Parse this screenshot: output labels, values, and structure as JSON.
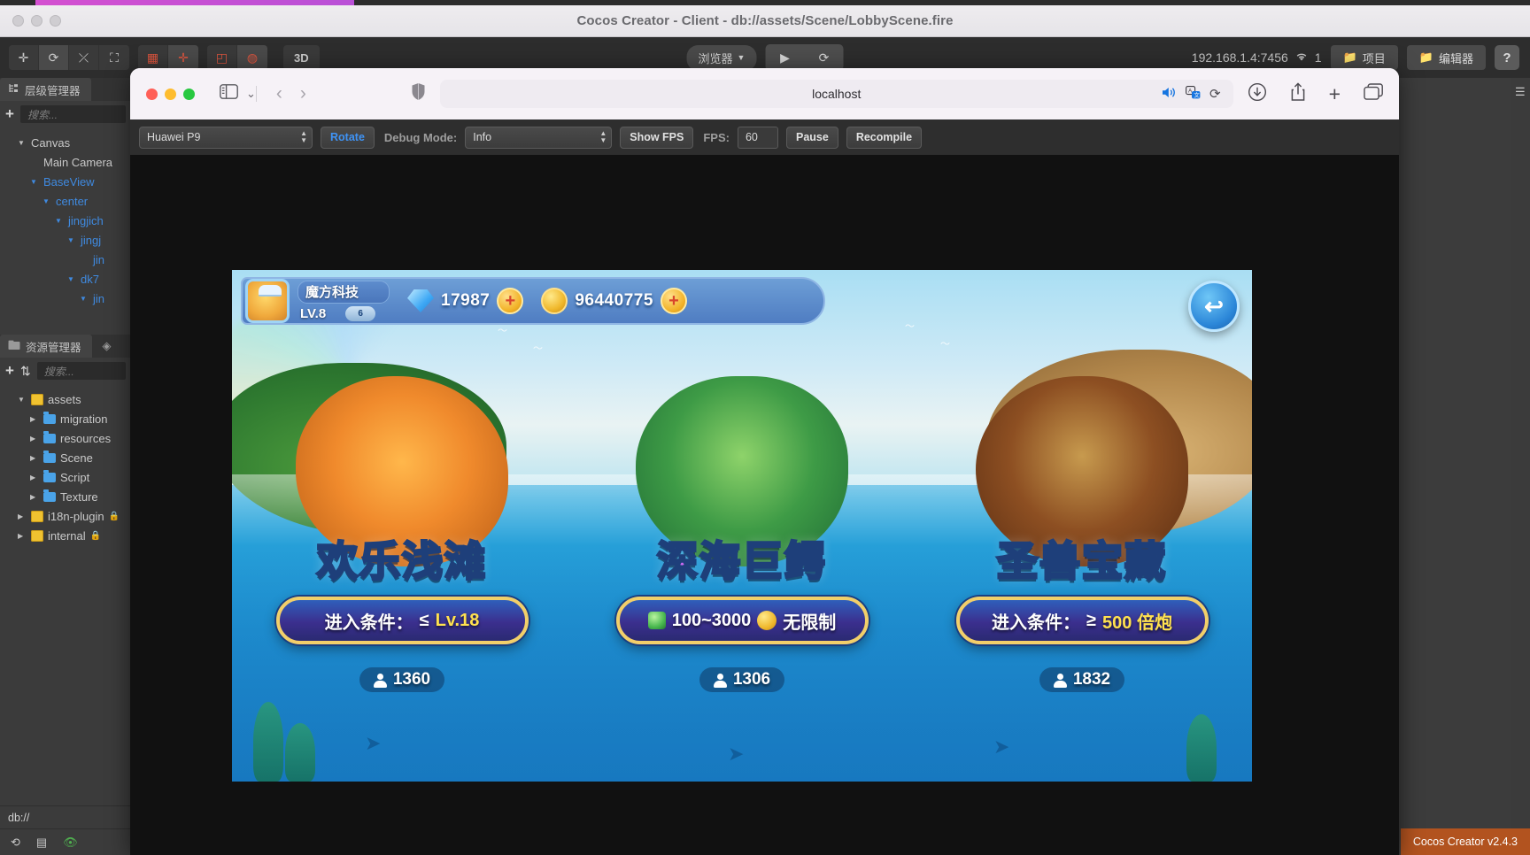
{
  "editor": {
    "window_title": "Cocos Creator - Client - db://assets/Scene/LobbyScene.fire",
    "toolbar": {
      "move_icon": "✛",
      "rotate_icon": "⟳",
      "scale_icon": "⤫",
      "rect_icon": "⛶",
      "anchor_icon": "▦",
      "pivot_icon": "✛",
      "rect_tool_icon": "◰",
      "global_icon": "◍",
      "mode_3d": "3D",
      "browser_label": "浏览器",
      "browser_caret": "▼",
      "play_icon": "▶",
      "refresh_icon": "⟳",
      "ip_address": "192.168.1.4:7456",
      "wifi_icon": "✦",
      "device_count": "1",
      "project_button": "项目",
      "editor_button": "编辑器",
      "help_button": "?"
    },
    "hierarchy_panel": {
      "tab_label": "层级管理器",
      "tab_icon": "hierarchy-icon",
      "add_icon": "+",
      "search_placeholder": "搜索...",
      "nodes": [
        {
          "label": "Canvas",
          "indent": 1,
          "arrow": "▼",
          "blue": false
        },
        {
          "label": "Main Camera",
          "indent": 2,
          "arrow": "",
          "blue": false
        },
        {
          "label": "BaseView",
          "indent": 2,
          "arrow": "▼",
          "blue": true
        },
        {
          "label": "center",
          "indent": 3,
          "arrow": "▼",
          "blue": true
        },
        {
          "label": "jingjich",
          "indent": 4,
          "arrow": "▼",
          "blue": true
        },
        {
          "label": "jingj",
          "indent": 5,
          "arrow": "▼",
          "blue": true
        },
        {
          "label": "jin",
          "indent": 6,
          "arrow": "",
          "blue": true
        },
        {
          "label": "dk7",
          "indent": 5,
          "arrow": "▼",
          "blue": true
        },
        {
          "label": "jin",
          "indent": 6,
          "arrow": "▼",
          "blue": true
        }
      ]
    },
    "assets_panel": {
      "tab_label": "资源管理器",
      "tab2_icon": "layers-icon",
      "add_icon": "+",
      "sort_icon": "⇅",
      "search_placeholder": "搜索...",
      "nodes": [
        {
          "label": "assets",
          "indent": 1,
          "arrow": "▼",
          "type": "db"
        },
        {
          "label": "migration",
          "indent": 2,
          "arrow": "▶",
          "type": "folder"
        },
        {
          "label": "resources",
          "indent": 2,
          "arrow": "▶",
          "type": "folder"
        },
        {
          "label": "Scene",
          "indent": 2,
          "arrow": "▶",
          "type": "folder"
        },
        {
          "label": "Script",
          "indent": 2,
          "arrow": "▶",
          "type": "folder"
        },
        {
          "label": "Texture",
          "indent": 2,
          "arrow": "▶",
          "type": "folder"
        },
        {
          "label": "i18n-plugin",
          "indent": 1,
          "arrow": "▶",
          "type": "db",
          "locked": true
        },
        {
          "label": "internal",
          "indent": 1,
          "arrow": "▶",
          "type": "db",
          "locked": true
        }
      ]
    },
    "status": {
      "db_path": "db://",
      "icon_refresh": "⟲",
      "icon_list": "▤",
      "icon_eye": "👁"
    },
    "version_label": "Cocos Creator v2.4.3",
    "menu_icon": "☰"
  },
  "browser": {
    "traffic": [
      "close",
      "minimize",
      "zoom"
    ],
    "sidebar_icon": "sidebar-icon",
    "sidebar_caret": "⌄",
    "back_icon": "‹",
    "forward_icon": "›",
    "shield_icon": "shield-icon",
    "url_value": "localhost",
    "speaker_icon": "🔊",
    "translate_icon": "translate-icon",
    "reload_icon": "⟳",
    "download_icon": "download-icon",
    "share_icon": "share-icon",
    "newtab_icon": "+",
    "tabs_icon": "tabs-icon"
  },
  "debug_bar": {
    "device_select": "Huawei P9",
    "rotate_button": "Rotate",
    "debug_mode_label": "Debug Mode:",
    "debug_mode_select": "Info",
    "show_fps_button": "Show FPS",
    "fps_label": "FPS:",
    "fps_value": "60",
    "pause_button": "Pause",
    "recompile_button": "Recompile"
  },
  "game": {
    "hud": {
      "player_name": "魔方科技",
      "level": "LV.8",
      "vip_badge": "6",
      "gem_amount": "17987",
      "coin_amount": "96440775",
      "gem_plus": "+",
      "coin_plus": "+",
      "back_icon": "↩"
    },
    "rooms": [
      {
        "title": "欢乐浅滩",
        "title_color": "#7ee03c",
        "condition_prefix": "进入条件：",
        "condition_symbol": "≤",
        "condition_value": "Lv.18",
        "players": "1360",
        "player_icon": "person-icon"
      },
      {
        "title": "深海巨鳄",
        "title_color": "#d06bf5",
        "condition_prefix": "",
        "condition_symbol": "100~3000",
        "condition_value": "无限制",
        "players": "1306",
        "player_icon": "person-icon"
      },
      {
        "title": "圣兽宝藏",
        "title_color": "#ff4d3d",
        "condition_prefix": "进入条件：",
        "condition_symbol": "≥",
        "condition_value": "500 倍炮",
        "players": "1832",
        "player_icon": "person-icon"
      }
    ]
  }
}
